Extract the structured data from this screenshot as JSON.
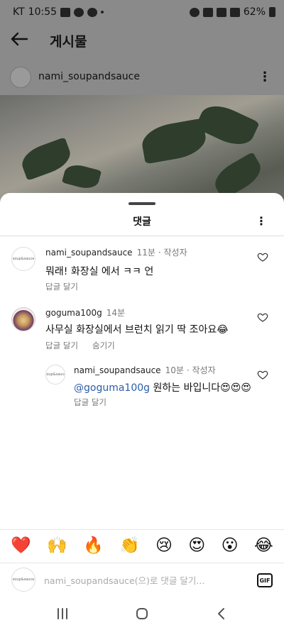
{
  "status_bar": {
    "carrier": "KT",
    "time": "10:55",
    "battery": "62%"
  },
  "post": {
    "title": "게시물",
    "author": "nami_soupandsauce"
  },
  "comments_sheet": {
    "title": "댓글",
    "comments": [
      {
        "username": "nami_soupandsauce",
        "time": "11분",
        "author_badge": "· 작성자",
        "text": "뭐래! 화장실 에서 ㅋㅋ 언",
        "reply_label": "답글 달기"
      },
      {
        "username": "goguma100g",
        "time": "14분",
        "author_badge": "",
        "text": "사무실 화장실에서 브런치 읽기 딱 조아요😂",
        "reply_label": "답글 달기",
        "hide_label": "숨기기"
      },
      {
        "username": "nami_soupandsauce",
        "time": "10분",
        "author_badge": "· 작성자",
        "mention": "@goguma100g",
        "text": " 원하는 바입니다😍😍😍",
        "reply_label": "답글 달기"
      }
    ]
  },
  "emoji_bar": [
    "❤️",
    "🙌",
    "🔥",
    "👏",
    "😢",
    "😍",
    "😮",
    "😂"
  ],
  "input": {
    "placeholder": "nami_soupandsauce(으)로 댓글 달기...",
    "gif_label": "GIF",
    "avatar_text": "soup&sauce"
  },
  "avatar_texts": {
    "nami": "soup&sauce"
  }
}
